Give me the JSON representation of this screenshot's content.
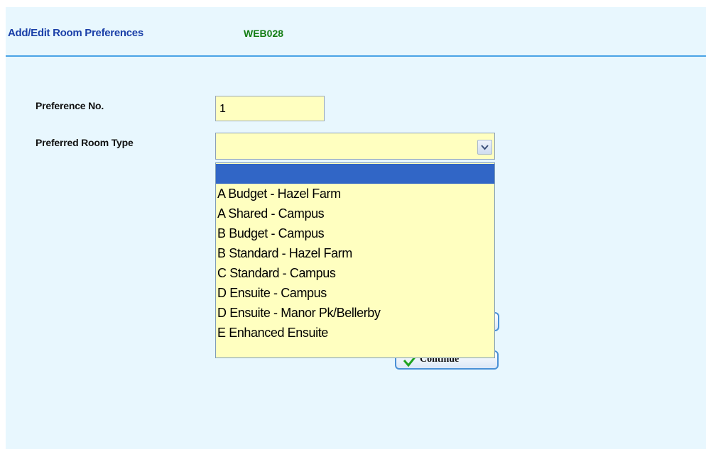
{
  "header": {
    "title": "Add/Edit Room Preferences",
    "code": "WEB028"
  },
  "form": {
    "preference_no": {
      "label": "Preference No.",
      "value": "1"
    },
    "room_type": {
      "label": "Preferred Room Type",
      "value": "",
      "options": [
        "",
        "A Budget - Hazel Farm",
        "A Shared - Campus",
        "B Budget - Campus",
        "B Standard - Hazel Farm",
        "C Standard - Campus",
        "D Ensuite - Campus",
        "D Ensuite - Manor Pk/Bellerby",
        "E Enhanced Ensuite"
      ],
      "highlighted_index": 0
    }
  },
  "buttons": {
    "continue_label": "Continue"
  },
  "icons": {
    "dropdown_arrow": "chevron-down-icon",
    "continue": "checkmark-icon"
  },
  "colors": {
    "panel_bg": "#e8f7fe",
    "title": "#1a3fa8",
    "code": "#137d13",
    "rule": "#4aa3e6",
    "field_bg": "#ffffc0",
    "highlight": "#3166c6",
    "checkmark": "#1fa31f"
  }
}
